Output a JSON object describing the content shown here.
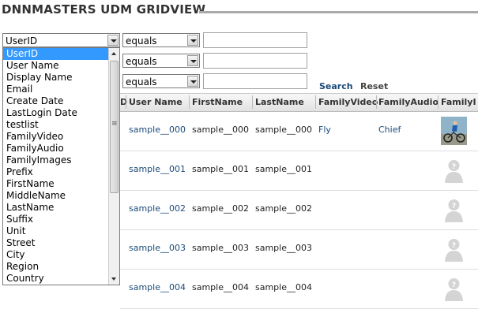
{
  "title": "DNNMASTERS UDM GRIDVIEW",
  "filters": [
    {
      "field": "UserID",
      "operator": "equals",
      "value": ""
    },
    {
      "field": "",
      "operator": "equals",
      "value": ""
    },
    {
      "field": "",
      "operator": "equals",
      "value": ""
    }
  ],
  "actions": {
    "search": "Search",
    "reset": "Reset"
  },
  "dropdown_options": [
    "UserID",
    "User Name",
    "Display Name",
    "Email",
    "Create Date",
    "LastLogin Date",
    "testlist",
    "FamilyVideo",
    "FamilyAudio",
    "FamilyImages",
    "Prefix",
    "FirstName",
    "MiddleName",
    "LastName",
    "Suffix",
    "Unit",
    "Street",
    "City",
    "Region",
    "Country"
  ],
  "dropdown_selected": "UserID",
  "grid": {
    "columns": [
      "D",
      "User Name",
      "FirstName",
      "LastName",
      "FamilyVideo",
      "FamilyAudio",
      "FamilyI"
    ],
    "rows": [
      {
        "user": "sample__000",
        "first": "sample__000",
        "last": "sample__000",
        "video": "Fly",
        "audio": "Chief",
        "image": "cyclist-photo"
      },
      {
        "user": "sample__001",
        "first": "sample__001",
        "last": "sample__001",
        "video": "",
        "audio": "",
        "image": "placeholder-avatar"
      },
      {
        "user": "sample__002",
        "first": "sample__002",
        "last": "sample__002",
        "video": "",
        "audio": "",
        "image": "placeholder-avatar"
      },
      {
        "user": "sample__003",
        "first": "sample__003",
        "last": "sample__003",
        "video": "",
        "audio": "",
        "image": "placeholder-avatar"
      },
      {
        "user": "sample__004",
        "first": "sample__004",
        "last": "sample__004",
        "video": "",
        "audio": "",
        "image": "placeholder-avatar"
      }
    ]
  }
}
